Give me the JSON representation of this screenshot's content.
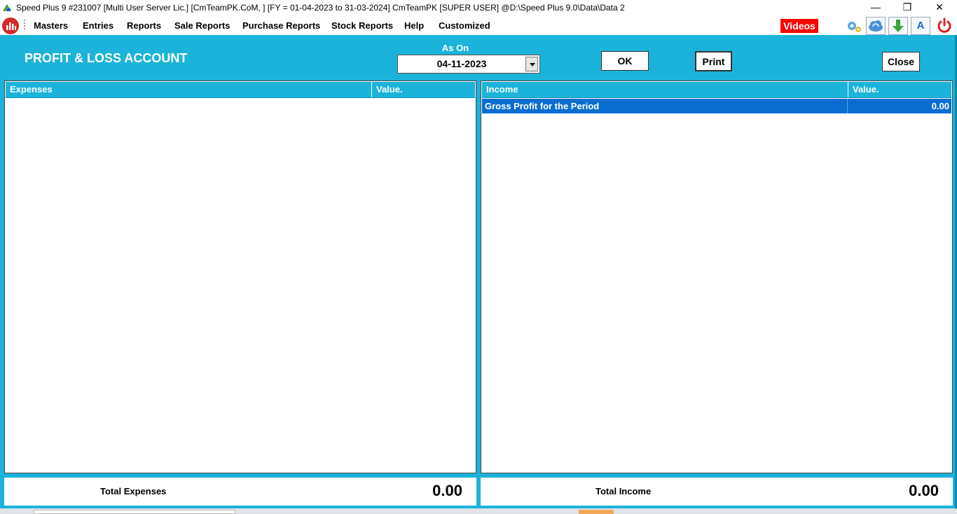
{
  "window": {
    "title": "Speed Plus 9 #231007  [Multi User Server Lic.]  [CmTeamPK.CoM, ] [FY = 01-04-2023 to 31-03-2024] CmTeamPK [SUPER USER]  @D:\\Speed Plus 9.0\\Data\\Data 2",
    "minimize_label": "—",
    "restore_label": "❐",
    "close_label": "✕"
  },
  "menu": {
    "items": [
      "Masters",
      "Entries",
      "Reports",
      "Sale Reports",
      "Purchase Reports",
      "Stock Reports",
      "Help",
      "Customized"
    ],
    "videos_label": "Videos",
    "font_tool_label": "A",
    "icons": [
      "chart-logo-icon",
      "gear-icon",
      "cloud-sync-icon",
      "download-arrow-icon",
      "font-icon",
      "power-icon"
    ]
  },
  "page": {
    "title": "PROFIT & LOSS ACCOUNT",
    "as_on_label": "As On",
    "date_value": "04-11-2023",
    "ok_label": "OK",
    "print_label": "Print",
    "close_label": "Close"
  },
  "expenses": {
    "headers": [
      "Expenses",
      "Value."
    ],
    "rows": [],
    "total_label": "Total Expenses",
    "total_value": "0.00"
  },
  "income": {
    "headers": [
      "Income",
      "Value."
    ],
    "rows": [
      {
        "name": "Gross Profit for the Period",
        "value": "0.00"
      }
    ],
    "total_label": "Total Income",
    "total_value": "0.00"
  },
  "colors": {
    "panel": "#1bb3d9",
    "selected_row": "#0a6ed1",
    "videos_badge": "#ff0000",
    "power": "#e02020"
  }
}
